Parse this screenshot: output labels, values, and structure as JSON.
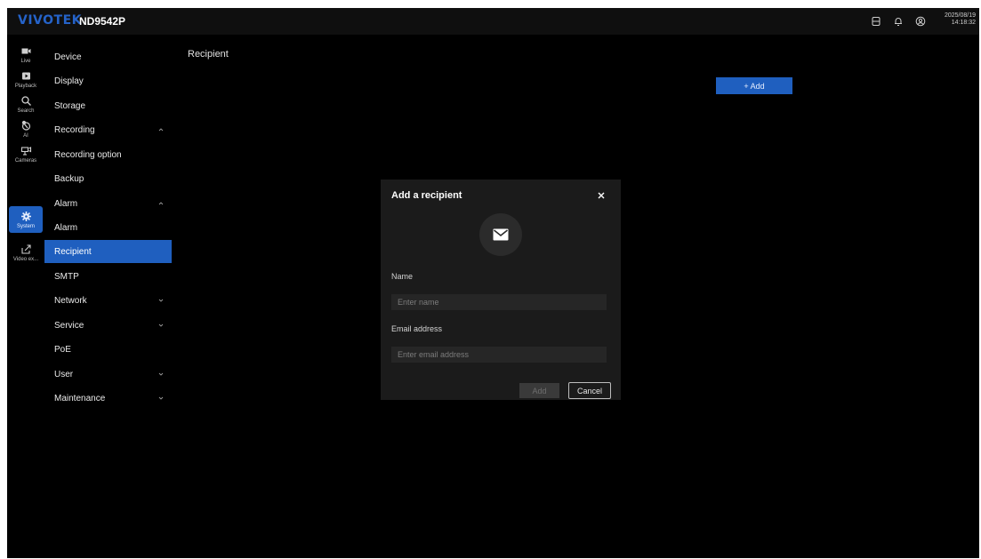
{
  "topbar": {
    "logo": "VIVOTEK",
    "model": "ND9542P",
    "date": "2025/08/19",
    "time": "14:18:32",
    "icons": [
      "storage-icon",
      "bell-icon",
      "user-icon"
    ]
  },
  "rail": {
    "items": [
      {
        "label": "Live",
        "icon": "video-camera-icon"
      },
      {
        "label": "Playback",
        "icon": "play-icon"
      },
      {
        "label": "Search",
        "icon": "search-icon"
      },
      {
        "label": "AI",
        "icon": "ai-icon"
      },
      {
        "label": "Cameras",
        "icon": "cameras-icon"
      },
      {
        "label": "System",
        "icon": "gear-icon",
        "active": true
      },
      {
        "label": "Video ex...",
        "icon": "export-icon"
      }
    ]
  },
  "menu": {
    "items": [
      {
        "label": "Device"
      },
      {
        "label": "Display"
      },
      {
        "label": "Storage"
      },
      {
        "label": "Recording",
        "chevron": "up"
      },
      {
        "label": "Recording option"
      },
      {
        "label": "Backup"
      },
      {
        "label": "Alarm",
        "chevron": "up"
      },
      {
        "label": "Alarm"
      },
      {
        "label": "Recipient",
        "active": true
      },
      {
        "label": "SMTP"
      },
      {
        "label": "Network",
        "chevron": "down"
      },
      {
        "label": "Service",
        "chevron": "down"
      },
      {
        "label": "PoE"
      },
      {
        "label": "User",
        "chevron": "down"
      },
      {
        "label": "Maintenance",
        "chevron": "down"
      }
    ]
  },
  "page": {
    "title": "Recipient",
    "add_label": "+ Add"
  },
  "modal": {
    "title": "Add a recipient",
    "close_icon": "close-icon",
    "mail_icon": "mail-icon",
    "name_label": "Name",
    "name_placeholder": "Enter name",
    "email_label": "Email address",
    "email_placeholder": "Enter email address",
    "add_label": "Add",
    "cancel_label": "Cancel"
  },
  "colors": {
    "accent": "#1f5fbf",
    "background": "#000000",
    "modal_bg": "#1b1b1b"
  }
}
